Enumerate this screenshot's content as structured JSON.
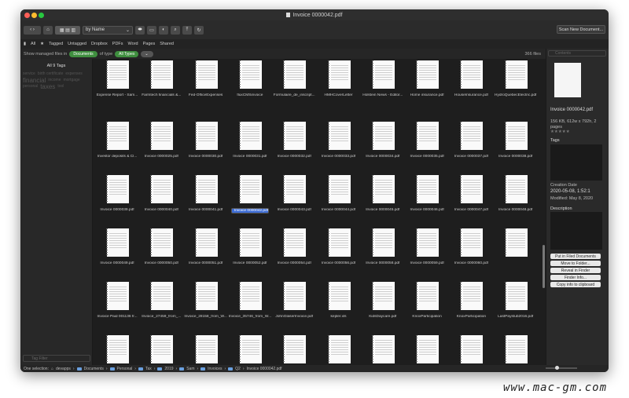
{
  "window": {
    "title": "Invoice 0000042.pdf"
  },
  "toolbar": {
    "sort": "by Name",
    "scan": "Scan New Document..."
  },
  "filters": [
    "All",
    "Tagged",
    "Untagged",
    "Dropbox",
    "PDFs",
    "Word",
    "Pages",
    "Shared"
  ],
  "options": {
    "show_label": "Show managed files in",
    "location": "Documents",
    "of_type": "of type",
    "type": "All Types",
    "count": "366 files"
  },
  "sidebar": {
    "tags_header": "All 9 Tags",
    "tags": [
      "service",
      "birth certificate",
      "expenses",
      "financial",
      "income",
      "mortgage",
      "personal",
      "taxes",
      "tool"
    ],
    "filter_placeholder": "Tag Filter"
  },
  "files": [
    "Expense Report - Sam...",
    "Farmtech financials &...",
    "Fed-OfficeExpenses",
    "fluxCMSinvoice",
    "Formulaire_de_inscript...",
    "HMHCoverLetter",
    "Holstein News - Editor...",
    "Home insurance.pdf",
    "HouseInsurance.pdf",
    "HydroQuebecElectric.pdf",
    "Investor deposits & Cl...",
    "Invoice 0000025.pdf",
    "Invoice 0000030.pdf",
    "Invoice 0000031.pdf",
    "Invoice 0000032.pdf",
    "Invoice 0000033.pdf",
    "Invoice 0000034.pdf",
    "Invoice 0000035.pdf",
    "Invoice 0000037.pdf",
    "Invoice 0000038.pdf",
    "Invoice 0000039.pdf",
    "Invoice 0000040.pdf",
    "Invoice 0000041.pdf",
    "Invoice 0000042.pdf",
    "Invoice 0000043.pdf",
    "Invoice 0000044.pdf",
    "Invoice 0000045.pdf",
    "Invoice 0000046.pdf",
    "Invoice 0000047.pdf",
    "Invoice 0000048.pdf",
    "Invoice 0000049.pdf",
    "Invoice 0000050.pdf",
    "Invoice 0000051.pdf",
    "Invoice 0000052.pdf",
    "Invoice 0000054.pdf",
    "Invoice 0000056.pdf",
    "Invoice 0000058.pdf",
    "Invoice 0000059.pdf",
    "Invoice 0000060.pdf",
    "",
    "Invoice Paid 001136 fr...",
    "Invoice_27459_from_...",
    "Invoice_28158_from_W...",
    "Invoice_35746_from_W...",
    "JohnGlaserInvoice.pdf",
    "kepler.xls",
    "KidsDaycare.pdf",
    "KnoxParticipation",
    "KnoxParticipation",
    "LastPaystub2016.pdf",
    "",
    "",
    "",
    "",
    "",
    "",
    "",
    "",
    "",
    ""
  ],
  "inspector": {
    "search_placeholder": "Contents",
    "name": "Invoice 0000042.pdf",
    "info": "156 KB, 612w x 792h, 2 pages",
    "tags_label": "Tags",
    "creation_label": "Creation Date",
    "creation_value": "2020-05-08,  1:52:1",
    "modified": "Modified: May 8, 2020",
    "description_label": "Description",
    "buttons": [
      "Put in Filed Documents",
      "Move to Folder...",
      "Reveal in Finder",
      "Finder Info...",
      "Copy info to clipboard"
    ]
  },
  "statusbar": {
    "selection": "One selection:",
    "path": [
      "devapps",
      "Documents",
      "Personal",
      "Tax",
      "2019",
      "Sam",
      "Invoices",
      "Q2",
      "Invoice 0000042.pdf"
    ]
  },
  "watermark": "www.mac-gm.com"
}
